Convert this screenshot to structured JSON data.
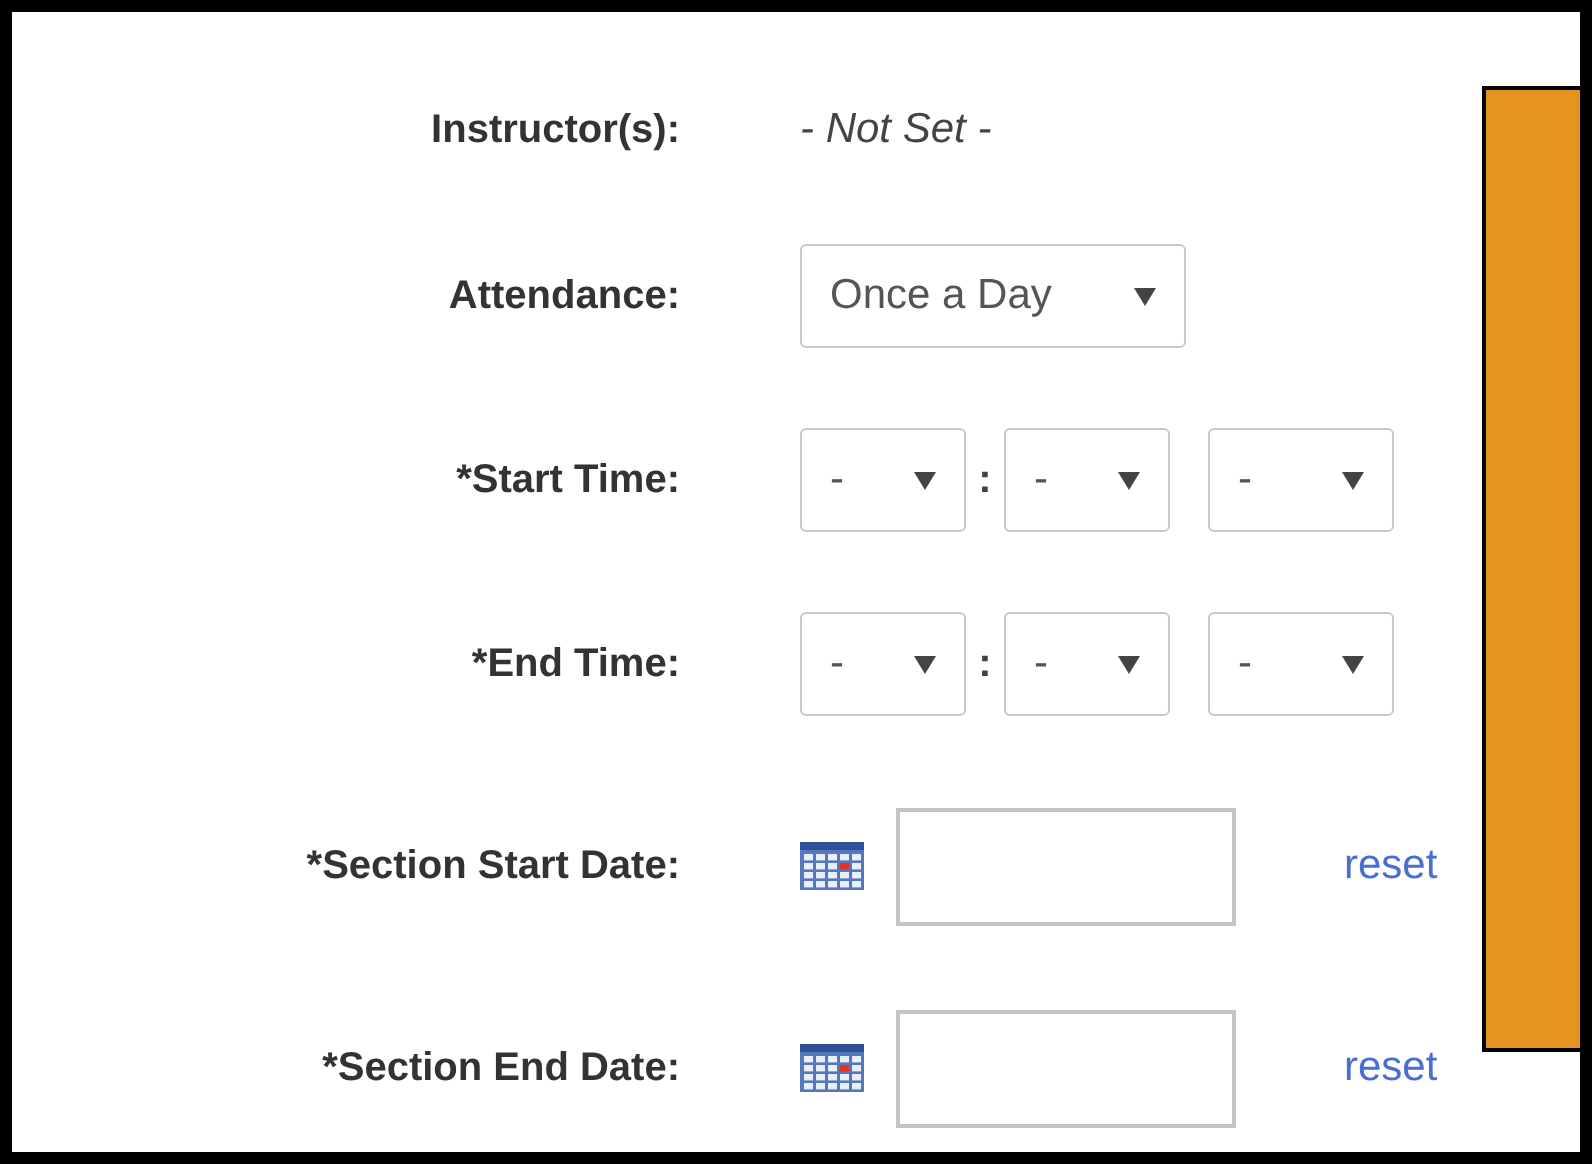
{
  "rows": [
    {
      "kind": "text",
      "label": "Instructor(s):",
      "value": "- Not Set -"
    },
    {
      "kind": "select",
      "label": "Attendance:",
      "value": "Once a Day"
    },
    {
      "kind": "time",
      "label": "*Start Time:",
      "hour": "-",
      "separator": ":",
      "minute": "-",
      "period": "-"
    },
    {
      "kind": "time",
      "label": "*End Time:",
      "hour": "-",
      "separator": ":",
      "minute": "-",
      "period": "-"
    },
    {
      "kind": "date",
      "label": "*Section Start Date:",
      "link": "reset"
    },
    {
      "kind": "date",
      "label": "*Section End Date:",
      "link": "reset"
    }
  ]
}
